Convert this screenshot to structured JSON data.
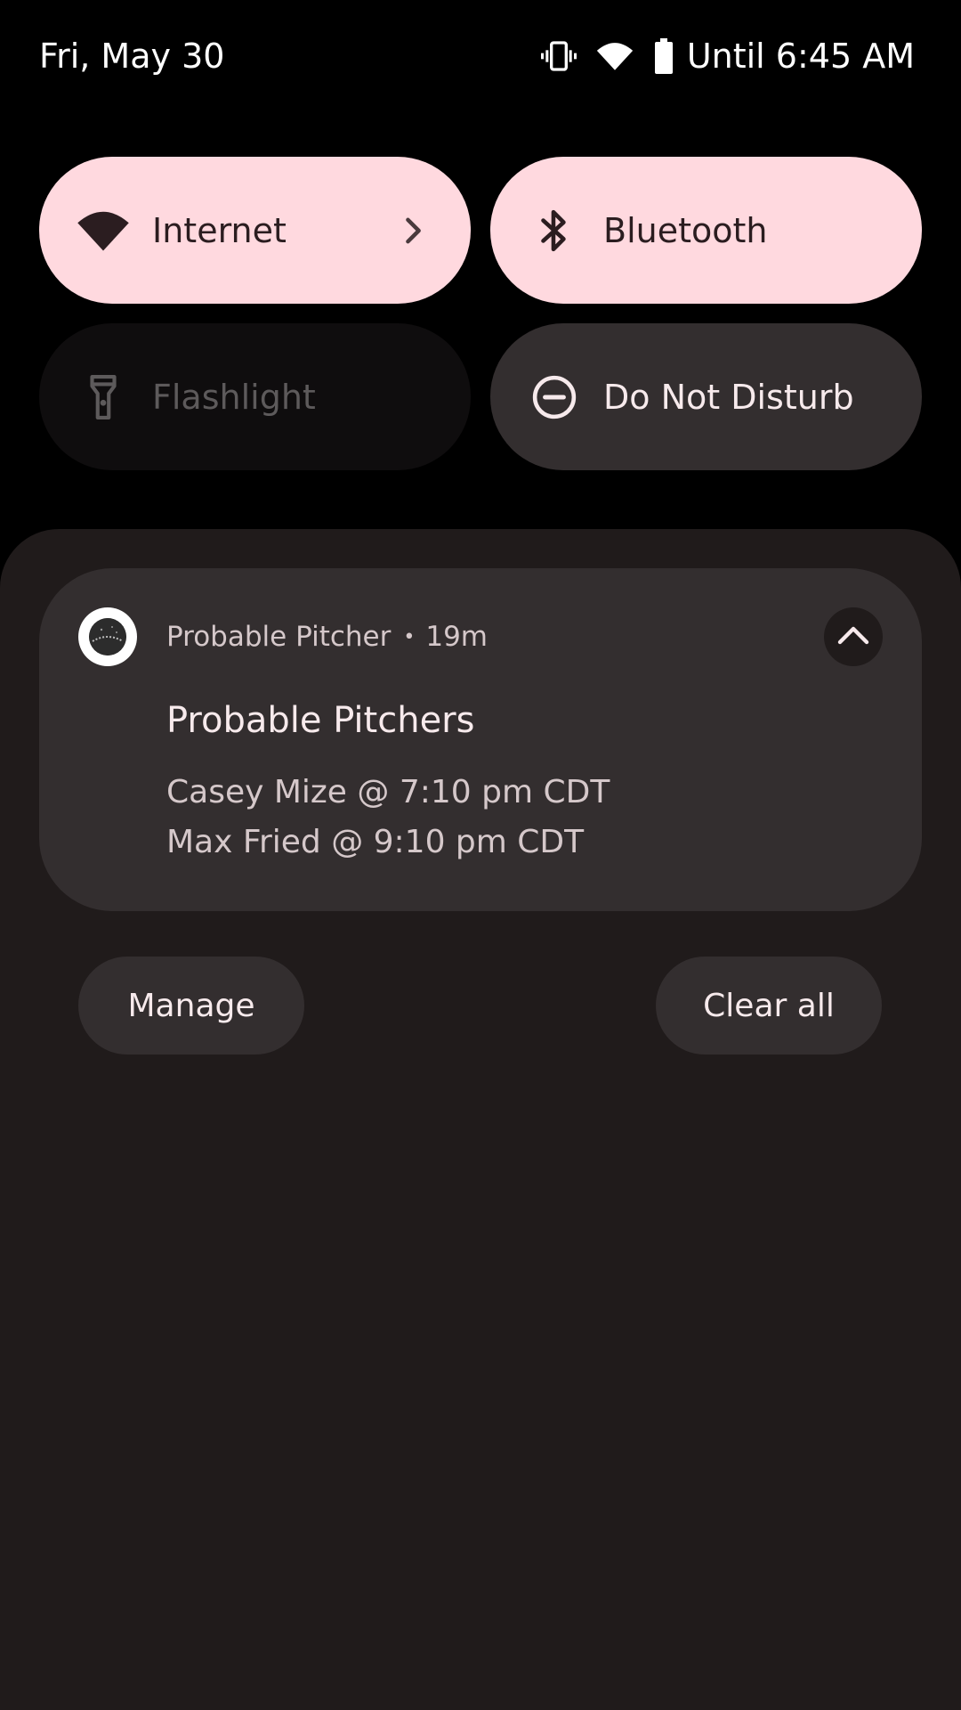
{
  "status_bar": {
    "date": "Fri, May 30",
    "alarm": "Until 6:45 AM",
    "icons": [
      "vibrate-icon",
      "wifi-icon",
      "battery-icon"
    ]
  },
  "quick_settings": {
    "tiles": [
      {
        "label": "Internet",
        "icon": "wifi-icon",
        "state": "on",
        "has_chevron": true
      },
      {
        "label": "Bluetooth",
        "icon": "bluetooth-icon",
        "state": "on"
      },
      {
        "label": "Flashlight",
        "icon": "flashlight-icon",
        "state": "unavailable"
      },
      {
        "label": "Do Not Disturb",
        "icon": "do-not-disturb-icon",
        "state": "off"
      }
    ]
  },
  "notification": {
    "app_name": "Probable Pitcher",
    "separator": "•",
    "time": "19m",
    "title": "Probable Pitchers",
    "lines": [
      "Casey Mize @ 7:10 pm CDT",
      "Max Fried @ 9:10 pm CDT"
    ],
    "app_icon": "baseball-icon",
    "collapse_icon": "chevron-up-icon"
  },
  "footer": {
    "manage_label": "Manage",
    "clear_all_label": "Clear all"
  },
  "colors": {
    "tile_on": "#ffd9df",
    "tile_off": "#332e2f",
    "tile_unavailable": "#0f0d0e",
    "shade_background": "#201b1b",
    "card_background": "#332e2f"
  }
}
